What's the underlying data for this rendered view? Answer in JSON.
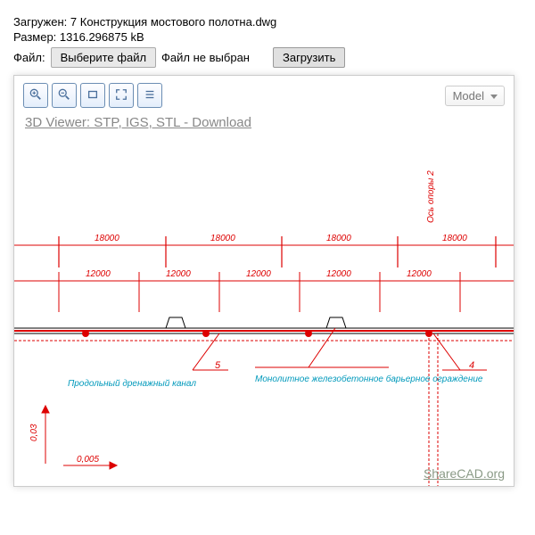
{
  "info": {
    "loaded_prefix": "Загружен:",
    "loaded_value": "7 Конструкция мостового полотна.dwg",
    "size_prefix": "Размер:",
    "size_value": "1316.296875 kB",
    "file_label": "Файл:"
  },
  "controls": {
    "choose_file": "Выберите файл",
    "no_file": "Файл не выбран",
    "upload": "Загрузить"
  },
  "toolbar": {
    "model_select": "Model"
  },
  "viewer_link": "3D Viewer: STP, IGS, STL - Download",
  "watermark": "ShareCAD.org",
  "drawing": {
    "top_dims": [
      "18000",
      "18000",
      "18000",
      "18000"
    ],
    "mid_dims": [
      "12000",
      "12000",
      "12000",
      "12000",
      "12000"
    ],
    "axis_label": "Ось опоры 2",
    "callouts": [
      "5",
      "4"
    ],
    "note1": "Продольный дренажный канал",
    "note2": "Монолитное железобетонное барьерное ограждение",
    "slope1": "0,03",
    "slope2": "0,005"
  }
}
